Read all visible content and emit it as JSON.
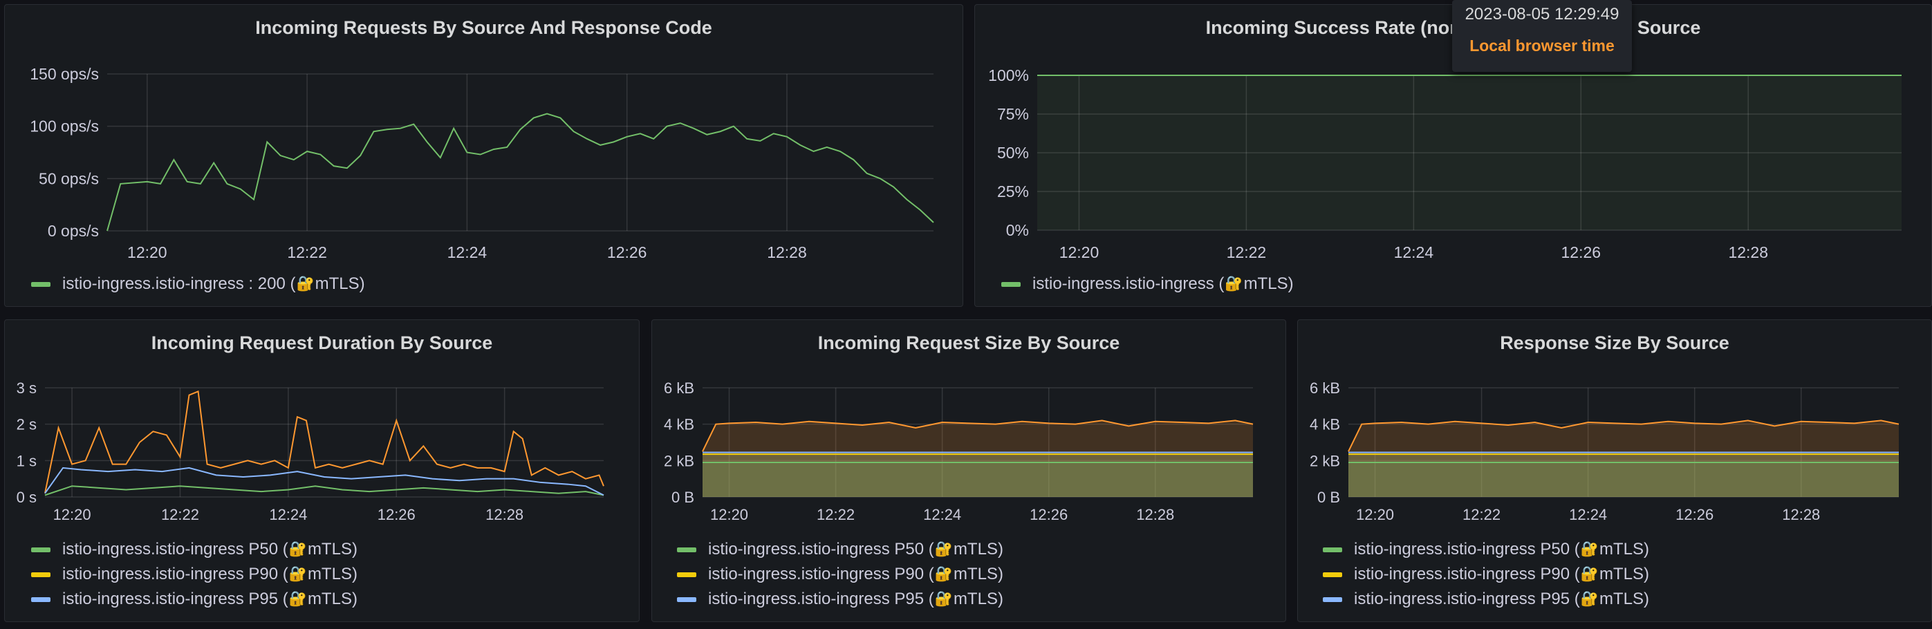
{
  "tooltip": {
    "time": "2023-08-05 12:29:49",
    "zone": "Local browser time"
  },
  "panels": {
    "requests": {
      "title": "Incoming Requests By Source And Response Code",
      "legend": [
        {
          "text": "istio-ingress.istio-ingress : 200 (",
          "suffix": "mTLS)",
          "color": "#73bf69"
        }
      ]
    },
    "success": {
      "title": "Incoming Success Rate (non-5xx responses) By Source",
      "legend": [
        {
          "text": "istio-ingress.istio-ingress (",
          "suffix": "mTLS)",
          "color": "#73bf69"
        }
      ]
    },
    "duration": {
      "title": "Incoming Request Duration By Source",
      "legend": [
        {
          "text": "istio-ingress.istio-ingress P50 (",
          "suffix": "mTLS)",
          "color": "#73bf69"
        },
        {
          "text": "istio-ingress.istio-ingress P90 (",
          "suffix": "mTLS)",
          "color": "#f2cc0c"
        },
        {
          "text": "istio-ingress.istio-ingress P95 (",
          "suffix": "mTLS)",
          "color": "#8ab8ff"
        }
      ]
    },
    "reqsize": {
      "title": "Incoming Request Size By Source",
      "legend": [
        {
          "text": "istio-ingress.istio-ingress P50 (",
          "suffix": "mTLS)",
          "color": "#73bf69"
        },
        {
          "text": "istio-ingress.istio-ingress P90 (",
          "suffix": "mTLS)",
          "color": "#f2cc0c"
        },
        {
          "text": "istio-ingress.istio-ingress P95 (",
          "suffix": "mTLS)",
          "color": "#8ab8ff"
        }
      ]
    },
    "respsize": {
      "title": "Response Size By Source",
      "legend": [
        {
          "text": "istio-ingress.istio-ingress P50 (",
          "suffix": "mTLS)",
          "color": "#73bf69"
        },
        {
          "text": "istio-ingress.istio-ingress P90 (",
          "suffix": "mTLS)",
          "color": "#f2cc0c"
        },
        {
          "text": "istio-ingress.istio-ingress P95 (",
          "suffix": "mTLS)",
          "color": "#8ab8ff"
        }
      ]
    }
  },
  "chart_data": [
    {
      "id": "requests",
      "type": "line",
      "title": "Incoming Requests By Source And Response Code",
      "xlim": [
        "12:19:30",
        "12:29:50"
      ],
      "x_ticks": [
        "12:20",
        "12:22",
        "12:24",
        "12:26",
        "12:28"
      ],
      "ylim": [
        0,
        150
      ],
      "y_ticks": [
        0,
        50,
        100,
        150
      ],
      "y_tick_labels": [
        "0 ops/s",
        "50 ops/s",
        "100 ops/s",
        "150 ops/s"
      ],
      "grid": true,
      "legend_position": "bottom",
      "series": [
        {
          "name": "istio-ingress.istio-ingress : 200 (🔐mTLS)",
          "color": "#73bf69",
          "x": [
            "12:19:30",
            "12:19:40",
            "12:20:00",
            "12:20:10",
            "12:20:20",
            "12:20:30",
            "12:20:40",
            "12:20:50",
            "12:21:00",
            "12:21:10",
            "12:21:20",
            "12:21:30",
            "12:21:40",
            "12:21:50",
            "12:22:00",
            "12:22:10",
            "12:22:20",
            "12:22:30",
            "12:22:40",
            "12:22:50",
            "12:23:00",
            "12:23:10",
            "12:23:20",
            "12:23:30",
            "12:23:40",
            "12:23:50",
            "12:24:00",
            "12:24:10",
            "12:24:20",
            "12:24:30",
            "12:24:40",
            "12:24:50",
            "12:25:00",
            "12:25:10",
            "12:25:20",
            "12:25:30",
            "12:25:40",
            "12:25:50",
            "12:26:00",
            "12:26:10",
            "12:26:20",
            "12:26:30",
            "12:26:40",
            "12:26:50",
            "12:27:00",
            "12:27:10",
            "12:27:20",
            "12:27:30",
            "12:27:40",
            "12:27:50",
            "12:28:00",
            "12:28:10",
            "12:28:20",
            "12:28:30",
            "12:28:40",
            "12:28:50",
            "12:29:00",
            "12:29:10",
            "12:29:20",
            "12:29:30",
            "12:29:40",
            "12:29:50"
          ],
          "values": [
            0,
            45,
            47,
            45,
            68,
            47,
            45,
            65,
            45,
            40,
            30,
            85,
            72,
            68,
            76,
            73,
            62,
            60,
            72,
            95,
            97,
            98,
            102,
            85,
            70,
            98,
            75,
            73,
            78,
            80,
            97,
            108,
            112,
            108,
            95,
            88,
            82,
            85,
            90,
            93,
            88,
            100,
            103,
            98,
            92,
            95,
            100,
            88,
            86,
            93,
            90,
            82,
            76,
            80,
            76,
            68,
            55,
            50,
            42,
            30,
            20,
            8
          ]
        }
      ]
    },
    {
      "id": "success",
      "type": "line",
      "title": "Incoming Success Rate (non-5xx responses) By Source",
      "xlim": [
        "12:19:30",
        "12:29:50"
      ],
      "x_ticks": [
        "12:20",
        "12:22",
        "12:24",
        "12:26",
        "12:28"
      ],
      "ylim": [
        0,
        100
      ],
      "y_ticks": [
        0,
        25,
        50,
        75,
        100
      ],
      "y_tick_labels": [
        "0%",
        "25%",
        "50%",
        "75%",
        "100%"
      ],
      "grid": true,
      "legend_position": "bottom",
      "series": [
        {
          "name": "istio-ingress.istio-ingress (🔐mTLS)",
          "color": "#73bf69",
          "x": [
            "12:19:30",
            "12:29:50"
          ],
          "values": [
            100,
            100
          ]
        }
      ]
    },
    {
      "id": "duration",
      "type": "line",
      "title": "Incoming Request Duration By Source",
      "xlim": [
        "12:19:30",
        "12:29:50"
      ],
      "x_ticks": [
        "12:20",
        "12:22",
        "12:24",
        "12:26",
        "12:28"
      ],
      "ylim": [
        0,
        3
      ],
      "y_ticks": [
        0,
        1,
        2,
        3
      ],
      "y_tick_labels": [
        "0 s",
        "1 s",
        "2 s",
        "3 s"
      ],
      "grid": true,
      "legend_position": "bottom",
      "series": [
        {
          "name": "istio-ingress.istio-ingress P50 (🔐mTLS)",
          "color": "#73bf69",
          "x": [
            "12:19:30",
            "12:20:00",
            "12:20:30",
            "12:21:00",
            "12:21:30",
            "12:22:00",
            "12:22:30",
            "12:23:00",
            "12:23:30",
            "12:24:00",
            "12:24:30",
            "12:25:00",
            "12:25:30",
            "12:26:00",
            "12:26:30",
            "12:27:00",
            "12:27:30",
            "12:28:00",
            "12:28:30",
            "12:29:00",
            "12:29:30",
            "12:29:50"
          ],
          "values": [
            0.05,
            0.3,
            0.25,
            0.2,
            0.25,
            0.3,
            0.25,
            0.2,
            0.15,
            0.2,
            0.3,
            0.2,
            0.15,
            0.2,
            0.25,
            0.2,
            0.15,
            0.2,
            0.15,
            0.1,
            0.15,
            0.05
          ]
        },
        {
          "name": "istio-ingress.istio-ingress P90 (🔐mTLS)",
          "color": "#ff9830",
          "x": [
            "12:19:30",
            "12:19:45",
            "12:20:00",
            "12:20:15",
            "12:20:30",
            "12:20:45",
            "12:21:00",
            "12:21:15",
            "12:21:30",
            "12:21:45",
            "12:22:00",
            "12:22:10",
            "12:22:20",
            "12:22:30",
            "12:22:45",
            "12:23:00",
            "12:23:15",
            "12:23:30",
            "12:23:45",
            "12:24:00",
            "12:24:10",
            "12:24:20",
            "12:24:30",
            "12:24:45",
            "12:25:00",
            "12:25:15",
            "12:25:30",
            "12:25:45",
            "12:26:00",
            "12:26:15",
            "12:26:30",
            "12:26:45",
            "12:27:00",
            "12:27:15",
            "12:27:30",
            "12:27:45",
            "12:28:00",
            "12:28:10",
            "12:28:20",
            "12:28:30",
            "12:28:45",
            "12:29:00",
            "12:29:15",
            "12:29:30",
            "12:29:45",
            "12:29:50"
          ],
          "values": [
            0.1,
            1.9,
            0.9,
            1.0,
            1.9,
            0.9,
            0.9,
            1.5,
            1.8,
            1.7,
            1.1,
            2.8,
            2.9,
            0.9,
            0.8,
            0.9,
            1.0,
            0.9,
            1.0,
            0.8,
            2.2,
            2.1,
            0.8,
            0.9,
            0.8,
            0.9,
            1.0,
            0.9,
            2.1,
            1.0,
            1.4,
            0.9,
            0.8,
            0.9,
            0.8,
            0.8,
            0.7,
            1.8,
            1.6,
            0.6,
            0.8,
            0.6,
            0.7,
            0.5,
            0.6,
            0.3
          ]
        },
        {
          "name": "istio-ingress.istio-ingress P95 (🔐mTLS)",
          "color": "#8ab8ff",
          "x": [
            "12:19:30",
            "12:19:50",
            "12:20:10",
            "12:20:40",
            "12:21:10",
            "12:21:40",
            "12:22:10",
            "12:22:40",
            "12:23:10",
            "12:23:40",
            "12:24:10",
            "12:24:40",
            "12:25:10",
            "12:25:40",
            "12:26:10",
            "12:26:40",
            "12:27:10",
            "12:27:40",
            "12:28:10",
            "12:28:40",
            "12:29:10",
            "12:29:30",
            "12:29:50"
          ],
          "values": [
            0.1,
            0.8,
            0.75,
            0.7,
            0.75,
            0.7,
            0.8,
            0.6,
            0.55,
            0.6,
            0.7,
            0.55,
            0.5,
            0.55,
            0.6,
            0.5,
            0.45,
            0.5,
            0.5,
            0.4,
            0.35,
            0.3,
            0.05
          ]
        }
      ]
    },
    {
      "id": "reqsize",
      "type": "area",
      "title": "Incoming Request Size By Source",
      "xlim": [
        "12:19:30",
        "12:29:50"
      ],
      "x_ticks": [
        "12:20",
        "12:22",
        "12:24",
        "12:26",
        "12:28"
      ],
      "ylim": [
        0,
        6000
      ],
      "y_ticks": [
        0,
        2000,
        4000,
        6000
      ],
      "y_tick_labels": [
        "0 B",
        "2 kB",
        "4 kB",
        "6 kB"
      ],
      "grid": true,
      "legend_position": "bottom",
      "series": [
        {
          "name": "istio-ingress.istio-ingress P50 (🔐mTLS)",
          "color": "#73bf69",
          "x": [
            "12:19:30",
            "12:29:50"
          ],
          "values": [
            1900,
            1900
          ]
        },
        {
          "name": "istio-ingress.istio-ingress P90 (🔐mTLS)",
          "color": "#f2cc0c",
          "x": [
            "12:19:30",
            "12:29:50"
          ],
          "values": [
            2350,
            2350
          ]
        },
        {
          "name": "istio-ingress.istio-ingress P95 (🔐mTLS)",
          "color": "#8ab8ff",
          "x": [
            "12:19:30",
            "12:29:50"
          ],
          "values": [
            2450,
            2450
          ]
        },
        {
          "name": "",
          "color": "#ff9830",
          "x": [
            "12:19:30",
            "12:19:45",
            "12:20:00",
            "12:20:30",
            "12:21:00",
            "12:21:30",
            "12:22:00",
            "12:22:30",
            "12:23:00",
            "12:23:30",
            "12:24:00",
            "12:24:30",
            "12:25:00",
            "12:25:30",
            "12:26:00",
            "12:26:30",
            "12:27:00",
            "12:27:30",
            "12:28:00",
            "12:28:30",
            "12:29:00",
            "12:29:30",
            "12:29:50"
          ],
          "values": [
            2500,
            4000,
            4050,
            4100,
            4000,
            4150,
            4050,
            3950,
            4100,
            3800,
            4100,
            4050,
            4000,
            4150,
            4050,
            4000,
            4200,
            3900,
            4150,
            4100,
            4050,
            4200,
            4000
          ]
        }
      ]
    },
    {
      "id": "respsize",
      "type": "area",
      "title": "Response Size By Source",
      "xlim": [
        "12:19:30",
        "12:29:50"
      ],
      "x_ticks": [
        "12:20",
        "12:22",
        "12:24",
        "12:26",
        "12:28"
      ],
      "ylim": [
        0,
        6000
      ],
      "y_ticks": [
        0,
        2000,
        4000,
        6000
      ],
      "y_tick_labels": [
        "0 B",
        "2 kB",
        "4 kB",
        "6 kB"
      ],
      "grid": true,
      "legend_position": "bottom",
      "series": [
        {
          "name": "istio-ingress.istio-ingress P50 (🔐mTLS)",
          "color": "#73bf69",
          "x": [
            "12:19:30",
            "12:29:50"
          ],
          "values": [
            1900,
            1900
          ]
        },
        {
          "name": "istio-ingress.istio-ingress P90 (🔐mTLS)",
          "color": "#f2cc0c",
          "x": [
            "12:19:30",
            "12:29:50"
          ],
          "values": [
            2350,
            2350
          ]
        },
        {
          "name": "istio-ingress.istio-ingress P95 (🔐mTLS)",
          "color": "#8ab8ff",
          "x": [
            "12:19:30",
            "12:29:50"
          ],
          "values": [
            2450,
            2450
          ]
        },
        {
          "name": "",
          "color": "#ff9830",
          "x": [
            "12:19:30",
            "12:19:45",
            "12:20:00",
            "12:20:30",
            "12:21:00",
            "12:21:30",
            "12:22:00",
            "12:22:30",
            "12:23:00",
            "12:23:30",
            "12:24:00",
            "12:24:30",
            "12:25:00",
            "12:25:30",
            "12:26:00",
            "12:26:30",
            "12:27:00",
            "12:27:30",
            "12:28:00",
            "12:28:30",
            "12:29:00",
            "12:29:30",
            "12:29:50"
          ],
          "values": [
            2500,
            4000,
            4050,
            4100,
            4000,
            4150,
            4050,
            3950,
            4100,
            3800,
            4100,
            4050,
            4000,
            4150,
            4050,
            4000,
            4200,
            3900,
            4150,
            4100,
            4050,
            4200,
            4000
          ]
        }
      ]
    }
  ]
}
